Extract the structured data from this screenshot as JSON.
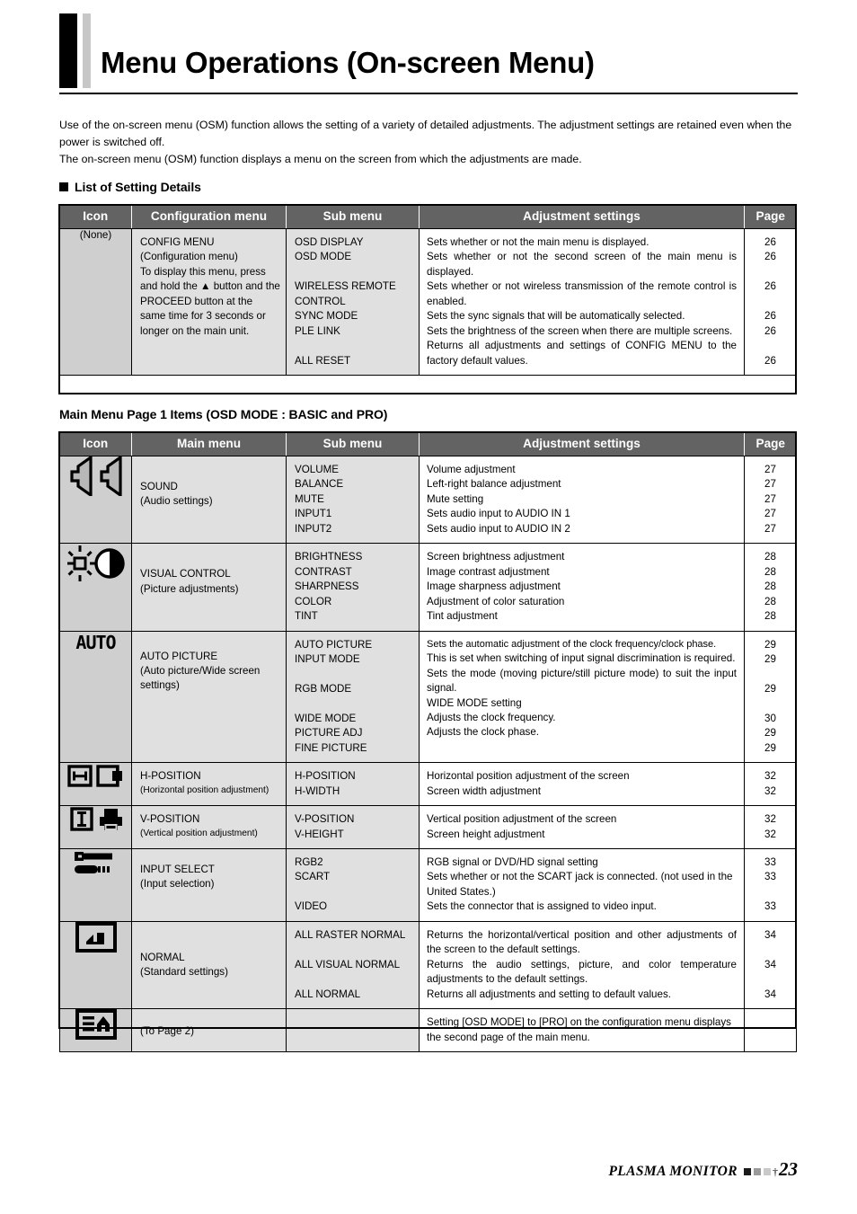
{
  "title": "Menu Operations (On-screen Menu)",
  "intro": {
    "line1": "Use of the on-screen menu (OSM) function allows the setting of a variety of detailed adjustments. The adjustment settings are retained even when the power is switched off.",
    "line2": "The on-screen menu (OSM) function displays a menu on the screen from which the adjustments are made."
  },
  "section1": {
    "heading": "List of Setting Details",
    "headers": [
      "Icon",
      "Configuration menu",
      "Sub menu",
      "Adjustment settings",
      "Page"
    ],
    "rows": [
      {
        "icon": "none-text",
        "icon_label": "(None)",
        "menu_title": "CONFIG MENU",
        "menu_sub": "(Configuration menu)",
        "menu_desc": "To display this menu, press and hold the ▲ button and the PROCEED button at the same time for 3 seconds or longer on the main unit.",
        "items": [
          {
            "sub": "OSD DISPLAY",
            "adj": "Sets whether or not the main menu is displayed.",
            "page": "26"
          },
          {
            "sub": "OSD MODE",
            "adj": "Sets whether or not the second screen of the main menu is displayed.",
            "page": "26"
          },
          {
            "sub": "WIRELESS REMOTE CONTROL",
            "adj": "Sets whether or not wireless transmission of the remote control is enabled.",
            "page": "26"
          },
          {
            "sub": "SYNC MODE",
            "adj": "Sets the sync signals that will be automatically selected.",
            "page": "26"
          },
          {
            "sub": "PLE LINK",
            "adj": "Sets the brightness of the screen when there are multiple screens.",
            "page": "26"
          },
          {
            "sub": "ALL RESET",
            "adj": "Returns all adjustments and settings of CONFIG MENU to the factory default values.",
            "page": "26"
          }
        ]
      }
    ]
  },
  "section2": {
    "heading": "Main Menu Page 1 Items (OSD MODE : BASIC and PRO)",
    "headers": [
      "Icon",
      "Main menu",
      "Sub menu",
      "Adjustment settings",
      "Page"
    ],
    "rows": [
      {
        "icon": "sound-speakers-icon",
        "menu_title": "SOUND",
        "menu_sub": "(Audio settings)",
        "subs": [
          "VOLUME",
          "BALANCE",
          "MUTE",
          "INPUT1",
          "INPUT2"
        ],
        "adjs": [
          "Volume adjustment",
          "Left-right balance adjustment",
          "Mute setting",
          "Sets audio input to AUDIO IN 1",
          "Sets audio input to AUDIO IN 2"
        ],
        "pages": [
          "27",
          "27",
          "27",
          "27",
          "27"
        ]
      },
      {
        "icon": "brightness-contrast-icon",
        "menu_title": "VISUAL CONTROL",
        "menu_sub": "(Picture adjustments)",
        "subs": [
          "BRIGHTNESS",
          "CONTRAST",
          "SHARPNESS",
          "COLOR",
          "TINT"
        ],
        "adjs": [
          "Screen brightness adjustment",
          "Image contrast adjustment",
          "Image sharpness adjustment",
          "Adjustment of color saturation",
          "Tint adjustment"
        ],
        "pages": [
          "28",
          "28",
          "28",
          "28",
          "28"
        ]
      },
      {
        "icon": "auto-text-icon",
        "menu_title": "AUTO PICTURE",
        "menu_sub": "(Auto picture/Wide screen settings)",
        "subs": [
          "AUTO PICTURE",
          "INPUT MODE",
          "RGB MODE",
          "WIDE MODE",
          "PICTURE ADJ",
          "FINE PICTURE"
        ],
        "adjs": [
          "Sets the automatic adjustment of the clock frequency/clock phase.",
          "This is set when switching of input signal discrimination is required.",
          "Sets the mode (moving picture/still picture mode) to suit the input signal.",
          "WIDE MODE setting",
          "Adjusts the clock frequency.",
          "Adjusts the clock phase."
        ],
        "pages": [
          "29",
          "29",
          "29",
          "30",
          "29",
          "29"
        ]
      },
      {
        "icon": "h-position-icon",
        "menu_title": "H-POSITION",
        "menu_sub": "(Horizontal position adjustment)",
        "subs": [
          "H-POSITION",
          "H-WIDTH"
        ],
        "adjs": [
          "Horizontal position adjustment of the screen",
          "Screen width adjustment"
        ],
        "pages": [
          "32",
          "32"
        ]
      },
      {
        "icon": "v-position-icon",
        "menu_title": "V-POSITION",
        "menu_sub": "(Vertical position adjustment)",
        "subs": [
          "V-POSITION",
          "V-HEIGHT"
        ],
        "adjs": [
          "Vertical position adjustment of the screen",
          "Screen height adjustment"
        ],
        "pages": [
          "32",
          "32"
        ]
      },
      {
        "icon": "input-select-wrench-icon",
        "menu_title": "INPUT SELECT",
        "menu_sub": "(Input selection)",
        "subs": [
          "RGB2",
          "SCART",
          "VIDEO"
        ],
        "adjs": [
          "RGB signal or DVD/HD signal setting",
          "Sets whether or not the SCART jack is connected. (not used in the United States.)",
          "Sets the connector that is assigned to video input."
        ],
        "pages": [
          "33",
          "33",
          "33"
        ]
      },
      {
        "icon": "normal-reset-icon",
        "menu_title": "NORMAL",
        "menu_sub": "(Standard settings)",
        "subs": [
          "ALL RASTER NORMAL",
          "ALL VISUAL NORMAL",
          "ALL NORMAL"
        ],
        "adjs": [
          "Returns the horizontal/vertical position and other adjustments of the screen to the default settings.",
          "Returns the audio settings, picture, and color temperature adjustments to the default settings.",
          "Returns all adjustments and setting to default values."
        ],
        "pages": [
          "34",
          "34",
          "34"
        ]
      },
      {
        "icon": "to-page-2-icon",
        "menu_title": "(To Page 2)",
        "menu_sub": "",
        "subs": [],
        "adjs": [
          "Setting [OSD MODE] to [PRO] on the configuration menu displays the second page of the main menu."
        ],
        "pages": [
          ""
        ]
      }
    ]
  },
  "footer": {
    "brand": "PLASMA MONITOR",
    "dagger": "†",
    "page_number": "23"
  }
}
